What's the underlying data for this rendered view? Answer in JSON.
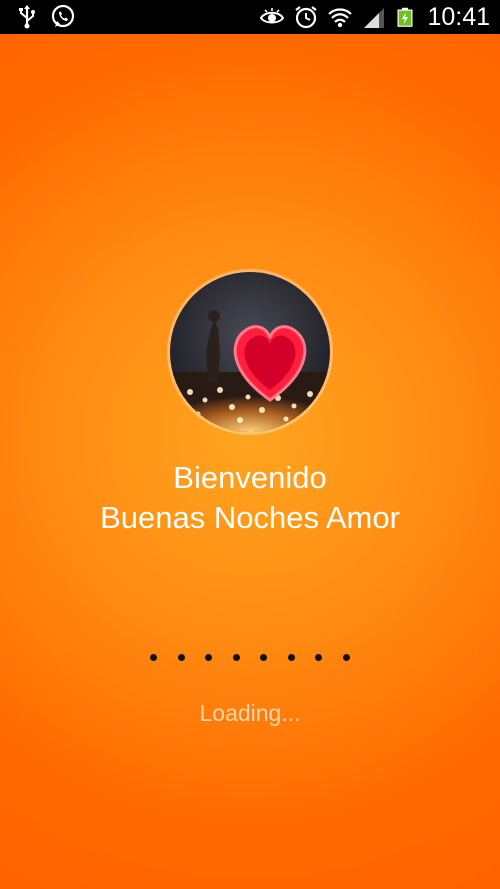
{
  "status_bar": {
    "time": "10:41",
    "icons_left": [
      "usb-icon",
      "whatsapp-icon"
    ],
    "icons_right": [
      "eye-icon",
      "alarm-icon",
      "wifi-icon",
      "signal-icon",
      "battery-icon"
    ]
  },
  "splash": {
    "welcome": "Bienvenido",
    "app_name": "Buenas Noches Amor",
    "loading": "Loading...",
    "dots_count": 8,
    "background_color": "#ff7a0a"
  }
}
